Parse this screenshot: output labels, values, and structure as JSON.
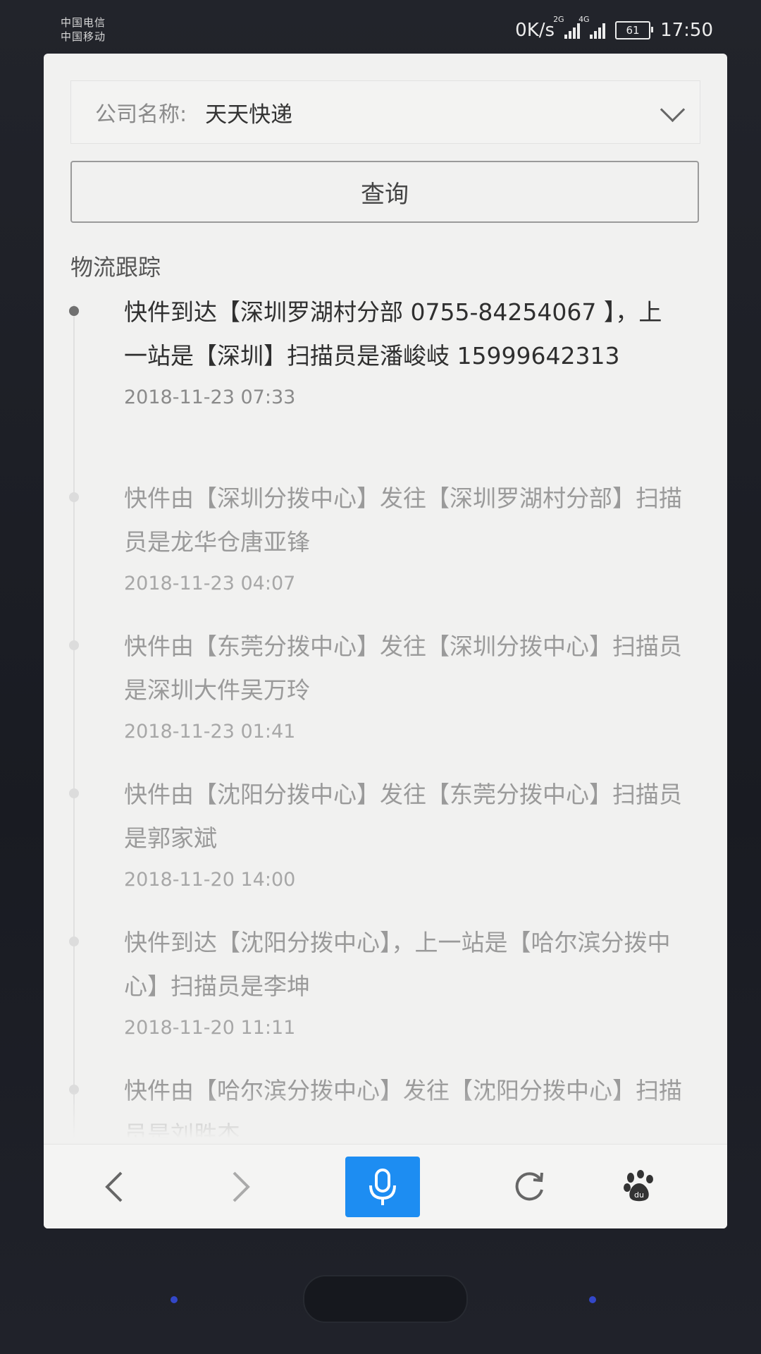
{
  "status_bar": {
    "carrier_1": "中国电信",
    "carrier_2": "中国移动",
    "speed": "0K/s",
    "net_1": "2G",
    "net_2": "4G",
    "battery": "61",
    "time": "17:50"
  },
  "form": {
    "company_label": "公司名称:",
    "company_value": "天天快递",
    "query_button": "查询"
  },
  "tracking": {
    "title": "物流跟踪",
    "events": [
      {
        "text": "快件到达【深圳罗湖村分部 0755-84254067 】，上一站是【深圳】扫描员是潘峻岐 15999642313",
        "time": "2018-11-23 07:33"
      },
      {
        "text": "快件由【深圳分拨中心】发往【深圳罗湖村分部】扫描员是龙华仓唐亚锋",
        "time": "2018-11-23 04:07"
      },
      {
        "text": "快件由【东莞分拨中心】发往【深圳分拨中心】扫描员是深圳大件吴万玲",
        "time": "2018-11-23 01:41"
      },
      {
        "text": "快件由【沈阳分拨中心】发往【东莞分拨中心】扫描员是郭家斌",
        "time": "2018-11-20 14:00"
      },
      {
        "text": "快件到达【沈阳分拨中心】，上一站是【哈尔滨分拨中心】扫描员是李坤",
        "time": "2018-11-20 11:11"
      },
      {
        "text": "快件由【哈尔滨分拨中心】发往【沈阳分拨中心】扫描员是刘胜杰",
        "time": ""
      }
    ]
  },
  "toolbar": {
    "back_icon": "chevron-left-icon",
    "forward_icon": "chevron-right-icon",
    "voice_icon": "microphone-icon",
    "refresh_icon": "refresh-icon",
    "baidu_icon": "baidu-paw-icon",
    "voice_color": "#1d8df2"
  }
}
